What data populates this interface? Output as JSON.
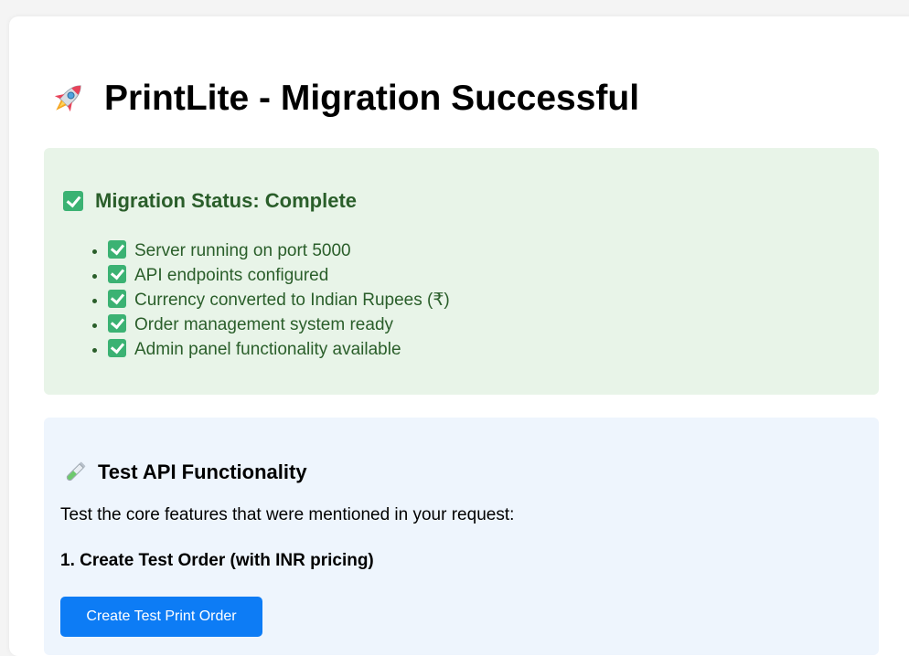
{
  "header": {
    "icon": "rocket-icon",
    "title": "PrintLite - Migration Successful"
  },
  "status": {
    "icon": "check-icon",
    "heading": "Migration Status: Complete",
    "items": [
      {
        "icon": "check-icon",
        "label": "Server running on port 5000"
      },
      {
        "icon": "check-icon",
        "label": "API endpoints configured"
      },
      {
        "icon": "check-icon",
        "label": "Currency converted to Indian Rupees (₹)"
      },
      {
        "icon": "check-icon",
        "label": "Order management system ready"
      },
      {
        "icon": "check-icon",
        "label": "Admin panel functionality available"
      }
    ]
  },
  "test": {
    "icon": "test-tube-icon",
    "heading": "Test API Functionality",
    "description": "Test the core features that were mentioned in your request:",
    "step1_title": "1. Create Test Order (with INR pricing)",
    "button_label": "Create Test Print Order"
  },
  "colors": {
    "status_bg": "#e8f4e8",
    "status_text": "#2a5e2a",
    "test_bg": "#eef5fd",
    "button_bg": "#0d7cf5",
    "check_green": "#3bb273"
  }
}
